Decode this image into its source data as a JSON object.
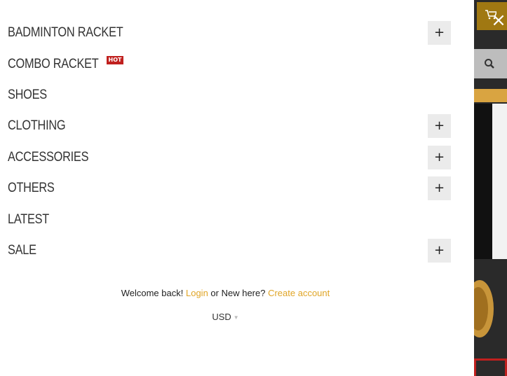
{
  "close_label": "×",
  "menu": [
    {
      "label": "BADMINTON RACKET",
      "expandable": true
    },
    {
      "label": "COMBO RACKET",
      "badge": "HOT",
      "expandable": false
    },
    {
      "label": "SHOES",
      "expandable": false
    },
    {
      "label": "CLOTHING",
      "expandable": true
    },
    {
      "label": "ACCESSORIES",
      "expandable": true
    },
    {
      "label": "OTHERS",
      "expandable": true
    },
    {
      "label": "LATEST",
      "expandable": false
    },
    {
      "label": "SALE",
      "expandable": true
    }
  ],
  "expand_symbol": "+",
  "account": {
    "welcome_text": "Welcome back!",
    "login_label": "Login",
    "middle_text": "or New here?",
    "create_label": "Create account"
  },
  "currency": {
    "selected": "USD",
    "caret": "▼"
  },
  "colors": {
    "accent": "#e0a526",
    "hot_badge": "#c0201e",
    "expand_bg": "#ebebeb"
  },
  "icons": {
    "cart": "cart-icon",
    "search": "search-icon",
    "close": "close-icon"
  }
}
